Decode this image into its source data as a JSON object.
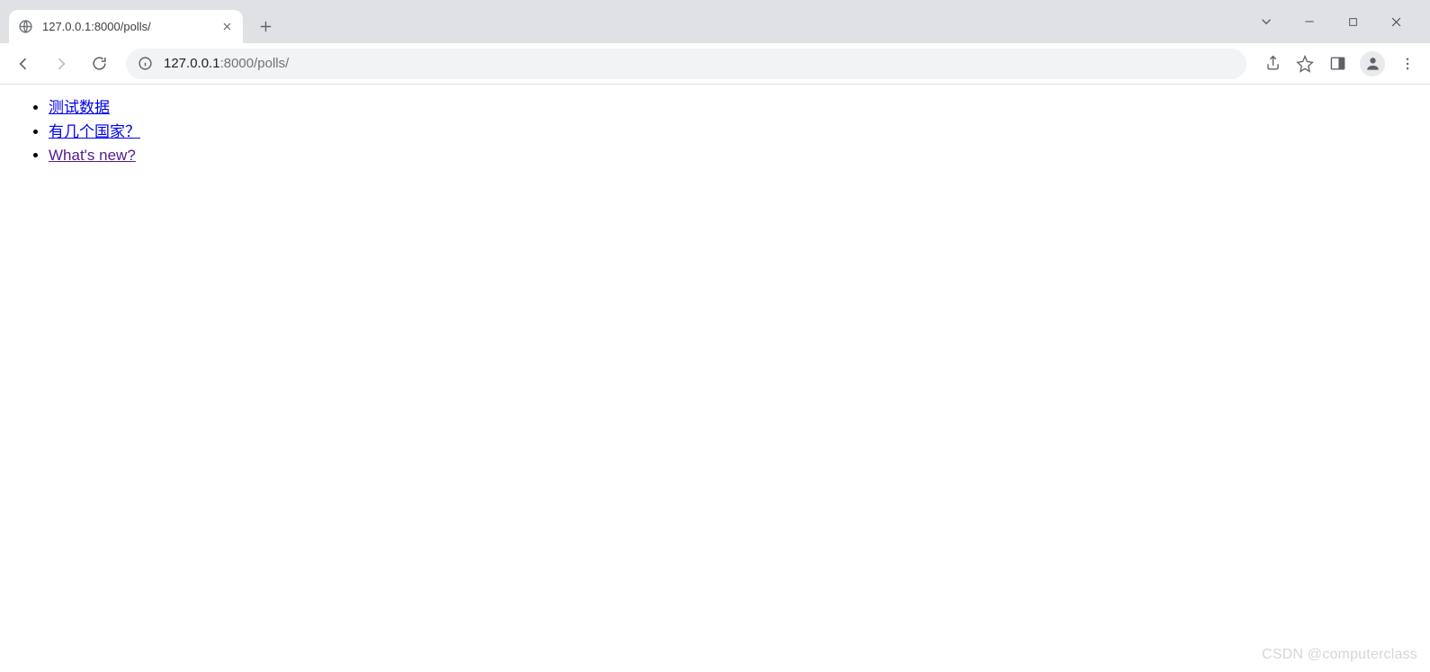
{
  "browser": {
    "tab_title": "127.0.0.1:8000/polls/",
    "window_controls": {
      "chevron": "⌄",
      "minimize": "—",
      "maximize": "☐",
      "close": "✕"
    },
    "tab_close_glyph": "✕",
    "new_tab_glyph": "+"
  },
  "toolbar": {
    "back": "←",
    "forward": "→",
    "reload": "⟳",
    "url_host": "127.0.0.1",
    "url_port_path": ":8000/polls/"
  },
  "page": {
    "links": [
      {
        "text": "测试数据",
        "visited": false
      },
      {
        "text": "有几个国家？",
        "visited": false
      },
      {
        "text": "What's new?",
        "visited": true
      }
    ]
  },
  "watermark": "CSDN @computerclass"
}
